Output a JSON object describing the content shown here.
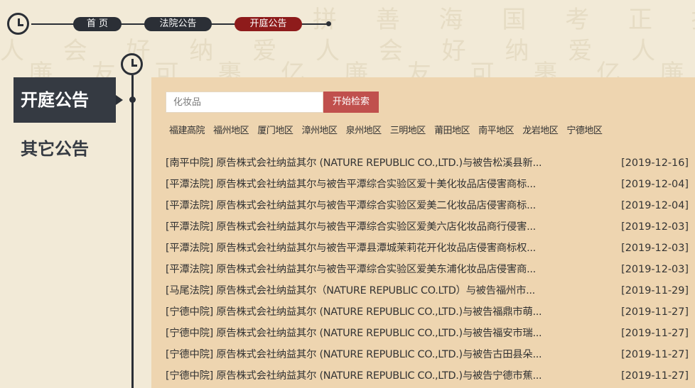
{
  "breadcrumb": {
    "items": [
      {
        "label": "首 页"
      },
      {
        "label": "法院公告"
      },
      {
        "label": "开庭公告"
      }
    ]
  },
  "sidebar": {
    "active_label": "开庭公告",
    "other_label": "其它公告"
  },
  "search": {
    "placeholder": "化妆品",
    "button_label": "开始检索"
  },
  "regions": [
    "福建高院",
    "福州地区",
    "厦门地区",
    "漳州地区",
    "泉州地区",
    "三明地区",
    "莆田地区",
    "南平地区",
    "龙岩地区",
    "宁德地区"
  ],
  "announcements": [
    {
      "title": "[南平中院] 原告株式会社纳益其尔 (NATURE REPUBLIC CO.,LTD.)与被告松溪县新...",
      "date": "[2019-12-16]"
    },
    {
      "title": "[平潭法院] 原告株式会社纳益其尔与被告平潭综合实验区爱十美化妆品店侵害商标...",
      "date": "[2019-12-04]"
    },
    {
      "title": "[平潭法院] 原告株式会社纳益其尔与被告平潭综合实验区爱美二化妆品店侵害商标...",
      "date": "[2019-12-04]"
    },
    {
      "title": "[平潭法院] 原告株式会社纳益其尔与被告平潭综合实验区爱美六店化妆品商行侵害...",
      "date": "[2019-12-03]"
    },
    {
      "title": "[平潭法院] 原告株式会社纳益其尔与被告平潭县潭城茉莉花开化妆品店侵害商标权...",
      "date": "[2019-12-03]"
    },
    {
      "title": "[平潭法院] 原告株式会社纳益其尔与被告平潭综合实验区爱美东浦化妆品店侵害商...",
      "date": "[2019-12-03]"
    },
    {
      "title": "[马尾法院] 原告株式会社纳益其尔（NATURE REPUBLIC CO.LTD）与被告福州市...",
      "date": "[2019-11-29]"
    },
    {
      "title": "[宁德中院] 原告株式会社纳益其尔 (NATURE REPUBLIC CO.,LTD.)与被告福鼎市萌...",
      "date": "[2019-11-27]"
    },
    {
      "title": "[宁德中院] 原告株式会社纳益其尔 (NATURE REPUBLIC CO.,LTD.)与被告福安市瑞...",
      "date": "[2019-11-27]"
    },
    {
      "title": "[宁德中院] 原告株式会社纳益其尔 (NATURE REPUBLIC CO.,LTD.)与被告古田县朵...",
      "date": "[2019-11-27]"
    },
    {
      "title": "[宁德中院] 原告株式会社纳益其尔 (NATURE REPUBLIC CO.,LTD.)与被告宁德市蕉...",
      "date": "[2019-11-27]"
    }
  ],
  "colors": {
    "page_bg": "#f2ead7",
    "panel_bg": "#eed5b0",
    "dark": "#2b2f36",
    "active_crumb": "#8e1b1b",
    "search_button": "#c0504d"
  },
  "icons": {
    "timeline": "clock-icon"
  }
}
